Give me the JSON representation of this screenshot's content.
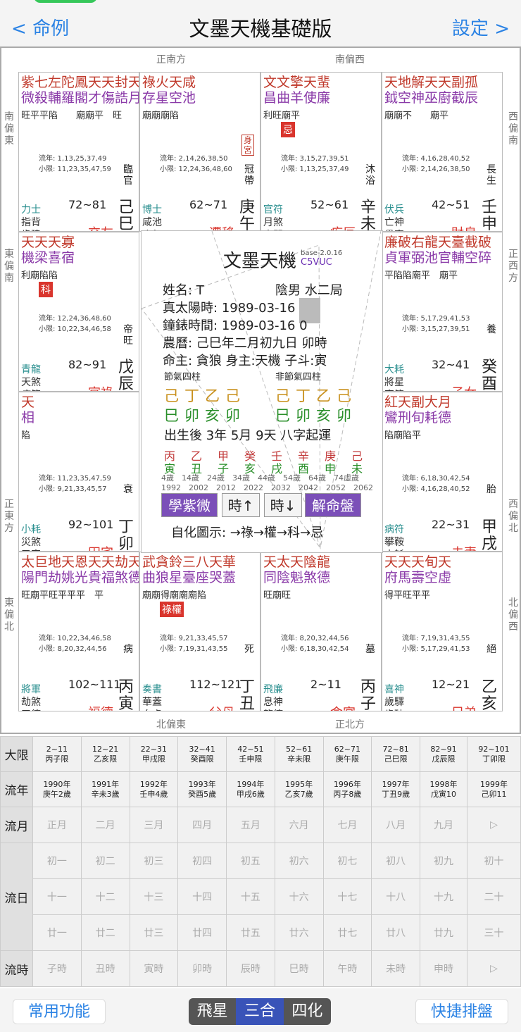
{
  "nav": {
    "back": "命例",
    "title": "文墨天機基礎版",
    "settings": "設定"
  },
  "dirs": {
    "top_left": "正南方",
    "top_right": "南偏西",
    "left_top": "南偏東",
    "left_mid": "東偏南",
    "left_low": "正東方",
    "left_bot": "東偏北",
    "right_top": "西偏南",
    "right_mid": "正西方",
    "right_low": "西偏北",
    "right_bot": "北偏西",
    "bot_left": "北偏東",
    "bot_right": "正北方"
  },
  "cells": [
    {
      "stars": "紫七左陀鳳天天封天年",
      "stars2": "微殺輔羅閣才傷誥月解",
      "bright": "旺平平陷　　廟廟平　旺",
      "flow1": "流年: 1,13,25,37,49",
      "flow2": "小限: 11,23,35,47,59",
      "range": "72~81",
      "doc1": "力士",
      "doc2a": "指背",
      "doc2b": "歲建",
      "pname": "交友",
      "st12": "臨官",
      "gz": "己巳"
    },
    {
      "stars": "祿火天咸",
      "stars2": "存星空池",
      "bright": "廟廟廟陷",
      "flow1": "流年: 2,14,26,38,50",
      "flow2": "小限: 12,24,36,48,60",
      "range": "62~71",
      "doc1": "博士",
      "doc2a": "咸池",
      "doc2b": "晦氣",
      "pname": "遷移",
      "st12": "冠帶",
      "gz": "庚午",
      "tag": "身宮"
    },
    {
      "stars": "文文擎天蜚",
      "stars2": "昌曲羊使廉",
      "bright": "利旺廟平",
      "flow1": "流年: 3,15,27,39,51",
      "flow2": "小限: 1,13,25,37,49",
      "range": "52~61",
      "doc1": "官符",
      "doc2a": "月煞",
      "doc2b": "喪門",
      "pname": "疾厄",
      "st12": "沐浴",
      "gz": "辛未",
      "sh": "忌"
    },
    {
      "stars": "天地解天天副孤",
      "stars2": "鉞空神巫廚截辰",
      "bright": "廟廟不　　廟平",
      "flow1": "流年: 4,16,28,40,52",
      "flow2": "小限: 2,14,26,38,50",
      "range": "42~51",
      "doc1": "伏兵",
      "doc2a": "亡神",
      "doc2b": "貫索",
      "pname": "財帛",
      "st12": "長生",
      "gz": "壬申"
    },
    {
      "stars": "天天天寡",
      "stars2": "機梁喜宿",
      "bright": "利廟陷陷",
      "flow1": "流年: 12,24,36,48,60",
      "flow2": "小限: 10,22,34,46,58",
      "range": "82~91",
      "doc1": "青龍",
      "doc2a": "天煞",
      "doc2b": "病符",
      "pname": "官祿",
      "st12": "帝旺",
      "gz": "戊辰",
      "sh": "科"
    },
    {
      "stars": "廉破右龍天臺截破",
      "stars2": "貞軍弼池官輔空碎",
      "bright": "平陷陷廟平　廟平",
      "flow1": "流年: 5,17,29,41,53",
      "flow2": "小限: 3,15,27,39,51",
      "range": "32~41",
      "doc1": "大耗",
      "doc2a": "將星",
      "doc2b": "官符",
      "pname": "子女",
      "st12": "養",
      "gz": "癸酉"
    },
    {
      "stars": "天",
      "stars2": "相",
      "bright": "陷",
      "flow1": "流年: 11,23,35,47,59",
      "flow2": "小限: 9,21,33,45,57",
      "range": "92~101",
      "doc1": "小耗",
      "doc2a": "災煞",
      "doc2b": "弔客",
      "pname": "田宅",
      "st12": "衰",
      "gz": "丁卯"
    },
    {
      "stars": "紅天副大月",
      "stars2": "鸞刑旬耗德",
      "bright": "陷廟陷平",
      "flow1": "流年: 6,18,30,42,54",
      "flow2": "小限: 4,16,28,40,52",
      "range": "22~31",
      "doc1": "病符",
      "doc2a": "攀鞍",
      "doc2b": "小耗",
      "pname": "夫妻",
      "st12": "胎",
      "gz": "甲戌"
    },
    {
      "stars": "太巨地天恩天天劫天",
      "stars2": "陽門劫姚光貴福煞德",
      "bright": "旺廟平旺平平平　平",
      "flow1": "流年: 10,22,34,46,58",
      "flow2": "小限: 8,20,32,44,56",
      "range": "102~111",
      "doc1": "將軍",
      "doc2a": "劫煞",
      "doc2b": "天德",
      "pname": "福德",
      "st12": "病",
      "gz": "丙寅"
    },
    {
      "stars": "武貪鈴三八天華",
      "stars2": "曲狼星臺座哭蓋",
      "bright": "廟廟得廟廟廟陷",
      "flow1": "流年: 9,21,33,45,57",
      "flow2": "小限: 7,19,31,43,55",
      "range": "112~121",
      "doc1": "奏書",
      "doc2a": "華蓋",
      "doc2b": "白虎",
      "pname": "父母",
      "st12": "死",
      "gz": "丁丑",
      "sh": "祿權"
    },
    {
      "stars": "天太天陰龍",
      "stars2": "同陰魁煞德",
      "bright": "旺廟旺",
      "flow1": "流年: 8,20,32,44,56",
      "flow2": "小限: 6,18,30,42,54",
      "range": "2~11",
      "doc1": "飛廉",
      "doc2a": "息神",
      "doc2b": "龍德",
      "pname": "命宮",
      "st12": "墓",
      "gz": "丙子"
    },
    {
      "stars": "天天天旬天",
      "stars2": "府馬壽空虛",
      "bright": "得平旺平平",
      "flow1": "流年: 7,19,31,43,55",
      "flow2": "小限: 5,17,29,41,53",
      "range": "12~21",
      "doc1": "喜神",
      "doc2a": "歲驛",
      "doc2b": "歲破",
      "pname": "兄弟",
      "st12": "絕",
      "gz": "乙亥"
    }
  ],
  "center": {
    "title": "文墨天機",
    "ver": "base-2.0.16",
    "code": "C5VUC",
    "name_lbl": "姓名: T",
    "gender": "陰男 水二局",
    "sun_lbl": "真太陽時:",
    "sun_val": "1989-03-16",
    "clock_lbl": "鐘錶時間:",
    "clock_val": "1989-03-16",
    "lunar": "農曆: 己巳年二月初九日 卯時",
    "master": "命主: 貪狼 身主:天機 子斗:寅",
    "jq": "節氣四柱",
    "njq": "非節氣四柱",
    "p1": "己丁乙己",
    "p2": "巳卯亥卯",
    "start": "出生後 3年 5月 9天 八字起運",
    "dayun": "丙乙甲癸壬辛庚己",
    "dayun2": "寅丑子亥戌酉申未",
    "ages": "4歲　14歲　24歲　34歲　44歲　54歲　64歲　74虛歲",
    "years": "1992　2002　2012　2022　2032　2042　2052　2062",
    "btn1": "學紫微",
    "btn2": "時↑",
    "btn3": "時↓",
    "btn4": "解命盤",
    "legend": "自化圖示: →祿→權→科→忌"
  },
  "limits": [
    "2~11\n丙子限",
    "12~21\n乙亥限",
    "22~31\n甲戌限",
    "32~41\n癸酉限",
    "42~51\n壬申限",
    "52~61\n辛未限",
    "62~71\n庚午限",
    "72~81\n己巳限",
    "82~91\n戊辰限",
    "92~101\n丁卯限"
  ],
  "years": [
    "1990年\n庚午2歲",
    "1991年\n辛未3歲",
    "1992年\n壬申4歲",
    "1993年\n癸酉5歲",
    "1994年\n甲戌6歲",
    "1995年\n乙亥7歲",
    "1996年\n丙子8歲",
    "1997年\n丁丑9歲",
    "1998年\n戊寅10",
    "1999年\n己卯11"
  ],
  "months": [
    "正月",
    "二月",
    "三月",
    "四月",
    "五月",
    "六月",
    "七月",
    "八月",
    "九月",
    "▷"
  ],
  "days1": [
    "初一",
    "初二",
    "初三",
    "初四",
    "初五",
    "初六",
    "初七",
    "初八",
    "初九",
    "初十"
  ],
  "days2": [
    "十一",
    "十二",
    "十三",
    "十四",
    "十五",
    "十六",
    "十七",
    "十八",
    "十九",
    "二十"
  ],
  "days3": [
    "廿一",
    "廿二",
    "廿三",
    "廿四",
    "廿五",
    "廿六",
    "廿七",
    "廿八",
    "廿九",
    "三十"
  ],
  "hours": [
    "子時",
    "丑時",
    "寅時",
    "卯時",
    "辰時",
    "巳時",
    "午時",
    "未時",
    "申時",
    "▷"
  ],
  "row_labels": {
    "limit": "大限",
    "year": "流年",
    "month": "流月",
    "day": "流日",
    "hour": "流時"
  },
  "footer": {
    "left": "常用功能",
    "seg": [
      "飛星",
      "三合",
      "四化"
    ],
    "right": "快捷排盤"
  }
}
